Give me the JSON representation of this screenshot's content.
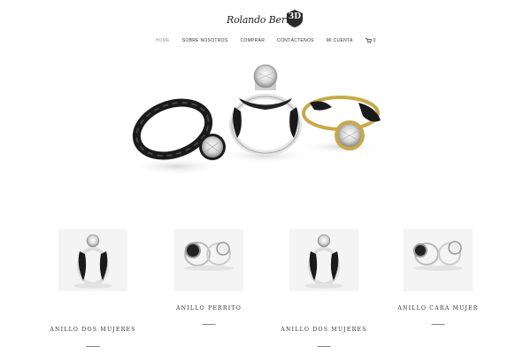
{
  "logo": {
    "script_text": "Rolando Bernal",
    "badge_text": "3D"
  },
  "nav": {
    "items": [
      {
        "label": "HOME",
        "active": true
      },
      {
        "label": "SOBRE NOSOTROS",
        "active": false
      },
      {
        "label": "COMPRAR",
        "active": false
      },
      {
        "label": "CONTÁCTENOS",
        "active": false
      },
      {
        "label": "MI CUENTA",
        "active": false
      }
    ],
    "cart_count": "0"
  },
  "products": [
    {
      "name": "ANILLO DOS MUJERES",
      "price": ""
    },
    {
      "name": "ANILLO PERRITO",
      "price": ""
    },
    {
      "name": "ANILLO DOS MUJERES",
      "price": ""
    },
    {
      "name": "ANILLO CARA MUJER",
      "price": ""
    }
  ],
  "colors": {
    "accent_black": "#1a1a1a",
    "gold": "#c8a94a",
    "silver": "#d9d9d9"
  }
}
